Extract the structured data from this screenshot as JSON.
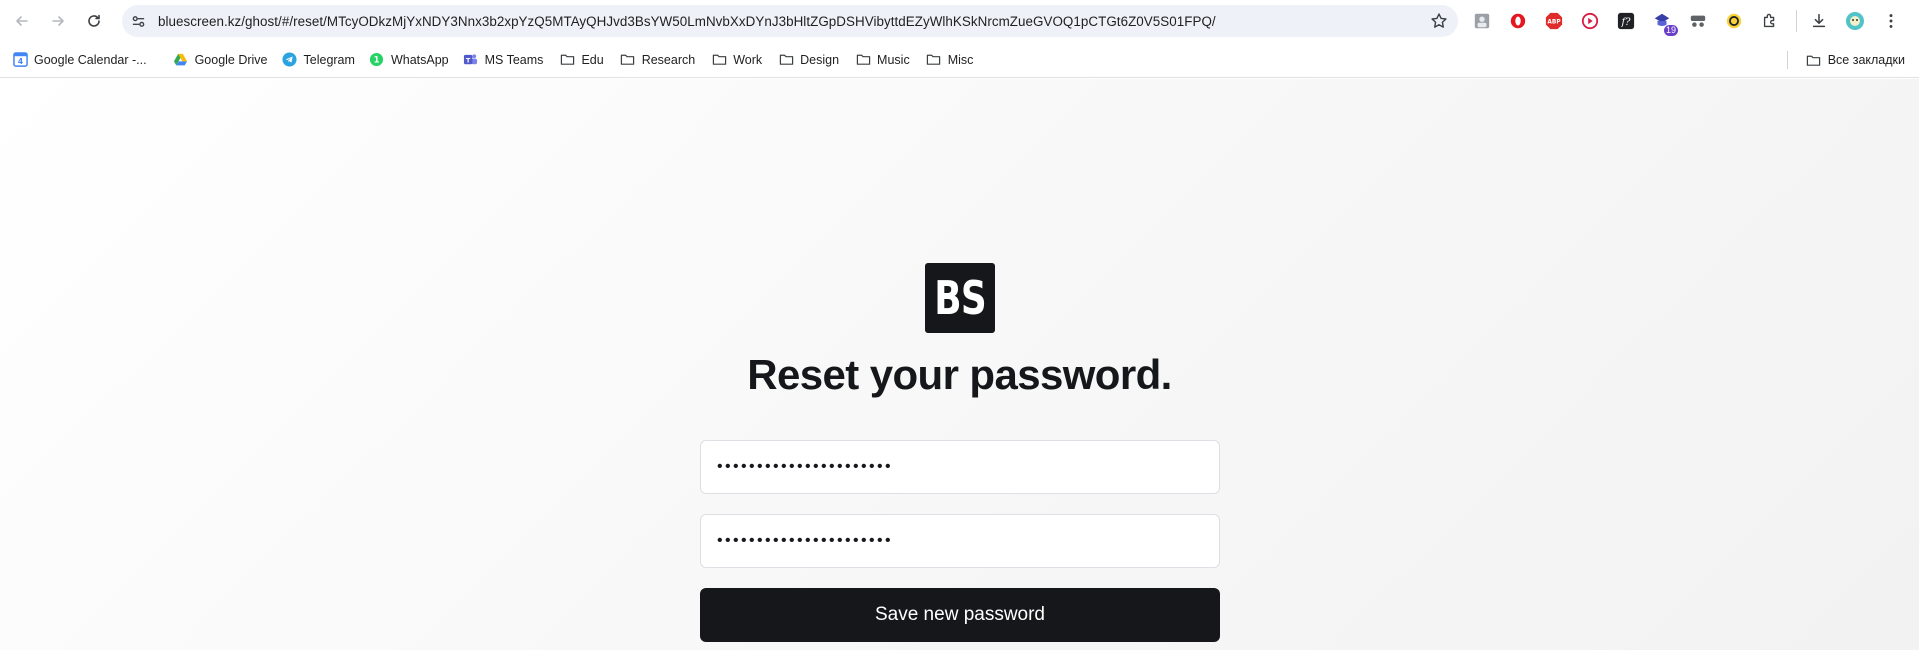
{
  "browser": {
    "url": "bluescreen.kz/ghost/#/reset/MTcyODkzMjYxNDY3Nnx3b2xpYzQ5MTAyQHJvd3BsYW50LmNvbXxDYnJ3bHltZGpDSHVibyttdEZyWlhKSkNrcmZueGVOQ1pCTGt6Z0V5S01FPQ/",
    "extension_badge_count": "19"
  },
  "bookmarks": {
    "items": [
      {
        "label": "Google Calendar -...",
        "icon": "google-calendar-icon"
      },
      {
        "label": "Google Drive",
        "icon": "google-drive-icon"
      },
      {
        "label": "Telegram",
        "icon": "telegram-icon"
      },
      {
        "label": "WhatsApp",
        "icon": "whatsapp-icon"
      },
      {
        "label": "MS Teams",
        "icon": "ms-teams-icon"
      },
      {
        "label": "Edu",
        "icon": "folder-icon"
      },
      {
        "label": "Research",
        "icon": "folder-icon"
      },
      {
        "label": "Work",
        "icon": "folder-icon"
      },
      {
        "label": "Design",
        "icon": "folder-icon"
      },
      {
        "label": "Music",
        "icon": "folder-icon"
      },
      {
        "label": "Misc",
        "icon": "folder-icon"
      }
    ],
    "all_bookmarks_label": "Все закладки"
  },
  "page": {
    "logo_text": "BS",
    "title": "Reset your password.",
    "new_password_masked": "••••••••••••••••••••••",
    "confirm_password_masked": "••••••••••••••••••••••",
    "save_button": "Save new password"
  },
  "colors": {
    "primary": "#15171a",
    "omnibox": "#eef1f8"
  }
}
